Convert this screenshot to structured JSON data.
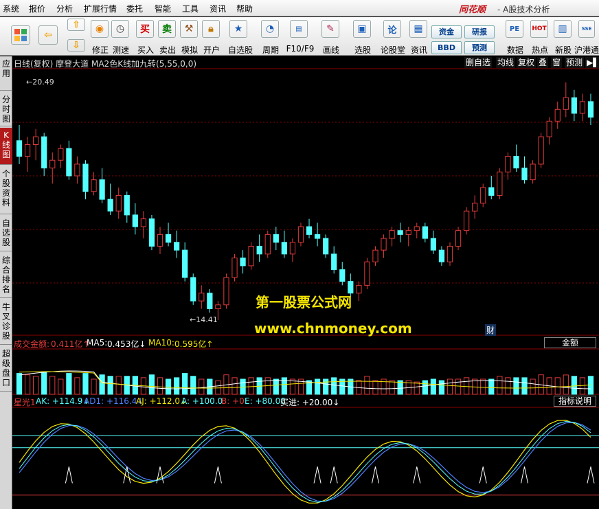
{
  "menu": [
    "系统",
    "报价",
    "分析",
    "扩展行情",
    "委托",
    "智能",
    "工具",
    "资讯",
    "帮助"
  ],
  "logo": "同花顺",
  "app_title": "- A股技术分析",
  "toolbar": {
    "buttons": [
      {
        "label": "",
        "icon": "grid-icon"
      },
      {
        "label": "",
        "icon": "back-arrow-icon"
      },
      {
        "label": "",
        "icon": "up-down-arrows-icon"
      },
      {
        "label": "修正",
        "icon": "revise-icon"
      },
      {
        "label": "测速",
        "icon": "speedtest-icon"
      },
      {
        "label": "买入",
        "icon": "buy-icon"
      },
      {
        "label": "卖出",
        "icon": "sell-icon"
      },
      {
        "label": "模拟",
        "icon": "hammer-icon"
      },
      {
        "label": "开户",
        "icon": "lock-icon"
      },
      {
        "label": "自选股",
        "icon": "star-icon"
      },
      {
        "label": "周期",
        "icon": "clock-icon"
      },
      {
        "label": "F10/F9",
        "icon": "f10-icon"
      },
      {
        "label": "画线",
        "icon": "pen-icon"
      },
      {
        "label": "选股",
        "icon": "monitor-icon"
      },
      {
        "label": "论股堂",
        "icon": "lun-icon"
      },
      {
        "label": "资讯",
        "icon": "news-icon"
      },
      {
        "label": "数据",
        "icon": "pe-icon"
      },
      {
        "label": "热点",
        "icon": "hot-icon"
      },
      {
        "label": "新股",
        "icon": "new-stock-icon"
      },
      {
        "label": "沪港通",
        "icon": "sse-hkex-icon"
      }
    ],
    "small_buttons": [
      "资金",
      "BBD",
      "研报",
      "预测"
    ]
  },
  "sidebar": [
    {
      "label": "应用"
    },
    {
      "label": "分时图"
    },
    {
      "label": "K线图",
      "active": true
    },
    {
      "label": "个股资料"
    },
    {
      "label": "自选股"
    },
    {
      "label": "综合排名"
    },
    {
      "label": "牛叉诊股"
    },
    {
      "label": "超级盘口"
    }
  ],
  "chart_head": {
    "title": "日线(复权)  摩登大道  MA2色K线加九转(5,55,0,0)",
    "buttons": [
      "删自选",
      "均线",
      "复权",
      "叠",
      "窗",
      "预测",
      "▶▌"
    ]
  },
  "price_labels": {
    "high": "20.49",
    "low": "14.41"
  },
  "watermark": {
    "line1": "第一股票公式网",
    "line2": "www.chnmoney.com",
    "cai": "财"
  },
  "volume_head": {
    "name": "成交金额:",
    "value": "0.411亿↑",
    "ma5_label": "MA5:",
    "ma5_value": "0.453亿↓",
    "ma10_label": "MA10:",
    "ma10_value": "0.595亿↑",
    "box": "金额"
  },
  "indicator_head": {
    "name": "星光1",
    "ak": "AK: +114.9↓",
    "ad1": "AD1: +116.4↓",
    "aj": "AJ: +112.0↓",
    "a": "A: +100.0",
    "b": "B: +0",
    "e": "E: +80.00",
    "buy": "买进: +20.00↓",
    "box": "指标说明"
  },
  "colors": {
    "up": "#e23b3b",
    "down": "#54ffff",
    "grid": "#8b0000",
    "yellow": "#f5e600"
  },
  "chart_data": {
    "type": "candlestick",
    "price_range": [
      14.41,
      20.49
    ],
    "ohlc": [
      [
        19.0,
        19.4,
        18.4,
        18.6
      ],
      [
        18.6,
        19.1,
        18.2,
        18.9
      ],
      [
        18.9,
        19.3,
        18.5,
        19.1
      ],
      [
        19.1,
        19.2,
        18.1,
        18.3
      ],
      [
        18.3,
        18.7,
        17.9,
        18.5
      ],
      [
        18.5,
        18.9,
        18.3,
        18.8
      ],
      [
        18.8,
        19.0,
        18.0,
        18.1
      ],
      [
        18.1,
        18.6,
        17.9,
        18.4
      ],
      [
        18.4,
        18.5,
        17.5,
        17.7
      ],
      [
        17.7,
        18.2,
        17.6,
        18.0
      ],
      [
        18.0,
        18.3,
        17.4,
        17.5
      ],
      [
        17.5,
        17.9,
        17.1,
        17.2
      ],
      [
        17.2,
        17.8,
        17.0,
        17.6
      ],
      [
        17.6,
        17.7,
        16.9,
        17.1
      ],
      [
        17.1,
        17.4,
        16.6,
        16.8
      ],
      [
        16.8,
        17.2,
        16.5,
        17.0
      ],
      [
        17.0,
        17.1,
        16.2,
        16.3
      ],
      [
        16.3,
        16.8,
        16.1,
        16.6
      ],
      [
        16.6,
        16.9,
        16.3,
        16.4
      ],
      [
        16.4,
        16.7,
        16.0,
        16.2
      ],
      [
        16.2,
        16.4,
        15.4,
        15.5
      ],
      [
        15.5,
        15.6,
        14.8,
        14.9
      ],
      [
        14.9,
        15.3,
        14.7,
        15.1
      ],
      [
        15.1,
        15.2,
        14.6,
        14.7
      ],
      [
        14.7,
        14.9,
        14.41,
        14.8
      ],
      [
        14.8,
        15.6,
        14.7,
        15.5
      ],
      [
        15.5,
        16.1,
        15.4,
        16.0
      ],
      [
        16.0,
        16.2,
        15.6,
        15.8
      ],
      [
        15.8,
        16.4,
        15.7,
        16.3
      ],
      [
        16.3,
        16.6,
        15.9,
        16.1
      ],
      [
        16.1,
        16.7,
        16.0,
        16.6
      ],
      [
        16.6,
        16.8,
        16.2,
        16.4
      ],
      [
        16.4,
        16.7,
        16.0,
        16.1
      ],
      [
        16.1,
        16.5,
        15.9,
        16.4
      ],
      [
        16.4,
        16.9,
        16.3,
        16.8
      ],
      [
        16.8,
        17.0,
        16.5,
        16.6
      ],
      [
        16.6,
        16.9,
        16.3,
        16.5
      ],
      [
        16.5,
        16.6,
        16.0,
        16.1
      ],
      [
        16.1,
        16.3,
        15.6,
        15.7
      ],
      [
        15.7,
        15.9,
        15.3,
        15.4
      ],
      [
        15.4,
        15.6,
        15.0,
        15.1
      ],
      [
        15.1,
        15.4,
        14.9,
        15.3
      ],
      [
        15.3,
        16.0,
        15.2,
        15.9
      ],
      [
        15.9,
        16.3,
        15.8,
        16.2
      ],
      [
        16.2,
        16.6,
        16.0,
        16.5
      ],
      [
        16.5,
        16.8,
        16.3,
        16.7
      ],
      [
        16.7,
        16.9,
        16.4,
        16.6
      ],
      [
        16.6,
        16.8,
        16.3,
        16.7
      ],
      [
        16.7,
        16.9,
        16.5,
        16.8
      ],
      [
        16.8,
        16.9,
        16.4,
        16.5
      ],
      [
        16.5,
        16.7,
        16.1,
        16.2
      ],
      [
        16.2,
        16.3,
        15.8,
        15.9
      ],
      [
        15.9,
        16.4,
        15.8,
        16.3
      ],
      [
        16.3,
        16.8,
        16.2,
        16.7
      ],
      [
        16.7,
        17.3,
        16.6,
        17.2
      ],
      [
        17.2,
        17.6,
        17.0,
        17.4
      ],
      [
        17.4,
        17.9,
        17.3,
        17.8
      ],
      [
        17.8,
        18.1,
        17.5,
        17.6
      ],
      [
        17.6,
        18.3,
        17.5,
        18.2
      ],
      [
        18.2,
        18.7,
        18.0,
        18.6
      ],
      [
        18.6,
        18.9,
        18.2,
        18.3
      ],
      [
        18.3,
        18.6,
        17.9,
        18.0
      ],
      [
        18.0,
        18.5,
        17.9,
        18.4
      ],
      [
        18.4,
        19.2,
        18.3,
        19.1
      ],
      [
        19.1,
        19.6,
        18.9,
        19.5
      ],
      [
        19.5,
        20.0,
        19.3,
        19.8
      ],
      [
        19.8,
        20.49,
        19.6,
        20.1
      ],
      [
        20.1,
        20.3,
        19.5,
        19.7
      ],
      [
        19.7,
        20.2,
        19.5,
        20.0
      ],
      [
        20.0,
        20.2,
        19.4,
        19.6
      ]
    ],
    "volume_ma": {
      "ma5": 0.453,
      "ma10": 0.595,
      "last": 0.411,
      "unit": "亿"
    },
    "indicator": {
      "name": "星光1",
      "AK": 114.9,
      "AD1": 116.4,
      "AJ": 112.0,
      "A": 100.0,
      "B": 0,
      "E": 80.0,
      "buy": 20.0
    }
  }
}
